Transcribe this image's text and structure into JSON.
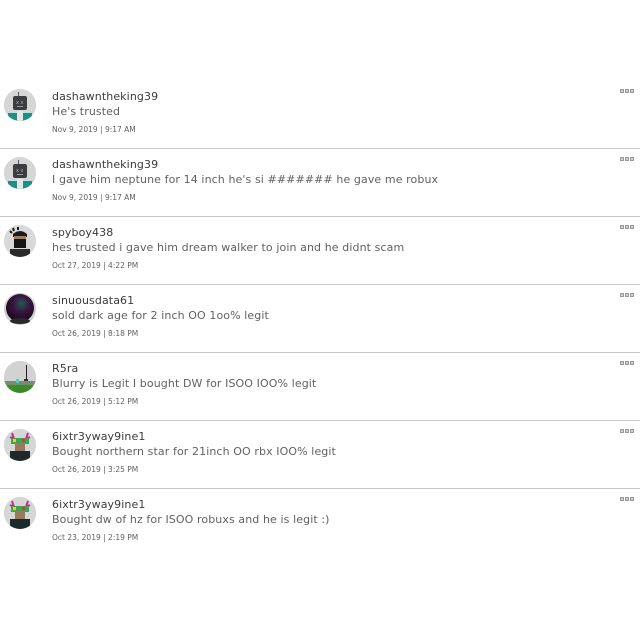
{
  "comments": [
    {
      "username": "dashawntheking39",
      "message": "He's trusted",
      "timestamp": "Nov 9, 2019 | 9:17 AM",
      "avatar": "robot-avatar"
    },
    {
      "username": "dashawntheking39",
      "message": "I gave him neptune for 14 inch he's si ####### he gave me robux",
      "timestamp": "Nov 9, 2019 | 9:17 AM",
      "avatar": "robot-avatar"
    },
    {
      "username": "spyboy438",
      "message": "hes trusted i gave him dream walker to join and he didnt scam",
      "timestamp": "Oct 27, 2019 | 4:22 PM",
      "avatar": "masked-avatar"
    },
    {
      "username": "sinuousdata61",
      "message": "sold dark age for 2 inch OO 1oo% legit",
      "timestamp": "Oct 26, 2019 | 8:18 PM",
      "avatar": "dark-orb-avatar"
    },
    {
      "username": "R5ra",
      "message": "Blurry is Legit I bought DW for ISOO IOO% legit",
      "timestamp": "Oct 26, 2019 | 5:12 PM",
      "avatar": "landscape-avatar"
    },
    {
      "username": "6ixtr3yway9ine1",
      "message": "Bought northern star for 21inch OO rbx IOO% legit",
      "timestamp": "Oct 26, 2019 | 3:25 PM",
      "avatar": "antler-avatar"
    },
    {
      "username": "6ixtr3yway9ine1",
      "message": "Bought dw of hz for ISOO robuxs and he is legit :)",
      "timestamp": "Oct 23, 2019 | 2:19 PM",
      "avatar": "antler-avatar"
    }
  ],
  "menu_icon": "more-options-icon",
  "colors": {
    "username": "#393b3d",
    "message": "#606162",
    "divider": "#c8c8c8",
    "background": "#ffffff"
  }
}
